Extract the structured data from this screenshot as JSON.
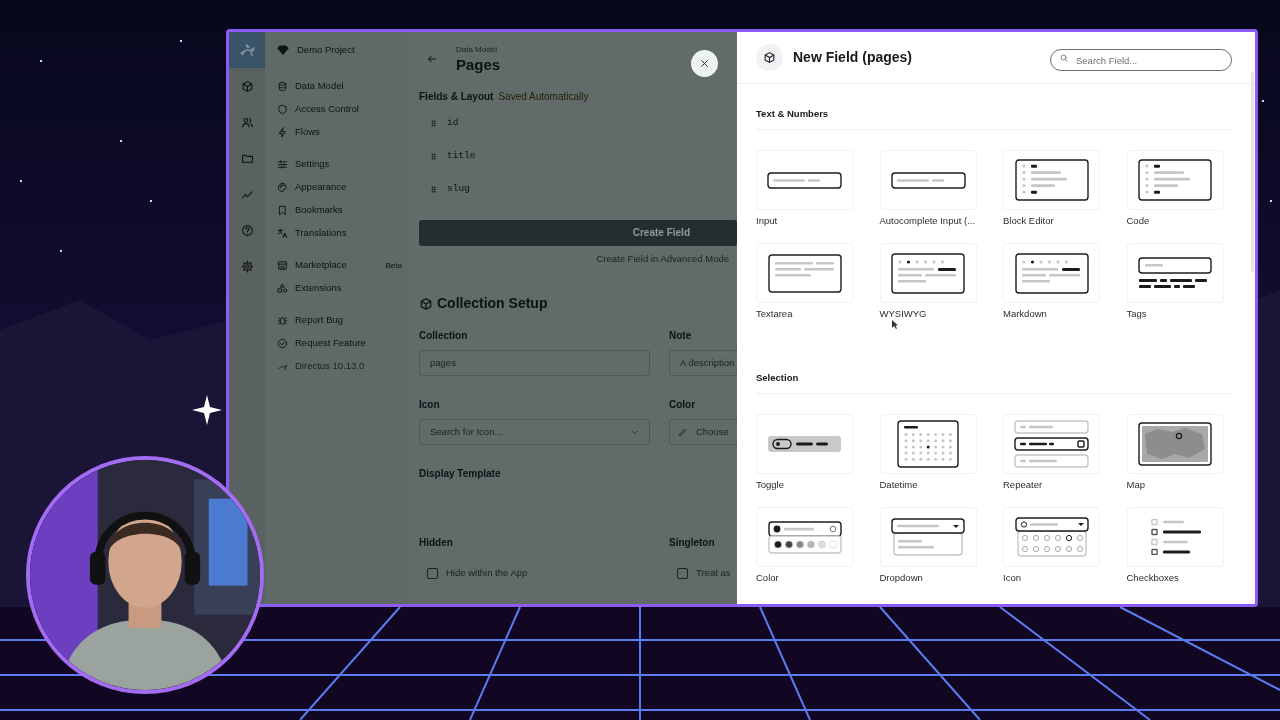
{
  "sidebar": {
    "project": "Demo Project",
    "groups": [
      {
        "items": [
          {
            "label": "Data Model"
          },
          {
            "label": "Access Control"
          },
          {
            "label": "Flows"
          }
        ]
      },
      {
        "items": [
          {
            "label": "Settings"
          },
          {
            "label": "Appearance"
          },
          {
            "label": "Bookmarks"
          },
          {
            "label": "Translations"
          }
        ]
      },
      {
        "items": [
          {
            "label": "Marketplace",
            "badge": "Beta"
          },
          {
            "label": "Extensions"
          }
        ]
      },
      {
        "items": [
          {
            "label": "Report Bug"
          },
          {
            "label": "Request Feature"
          }
        ]
      }
    ],
    "version": "Directus 10.13.0"
  },
  "header": {
    "breadcrumb": "Data Model",
    "title": "Pages"
  },
  "fields_layout": {
    "heading": "Fields & Layout",
    "status": "Saved Automatically",
    "fields": [
      "id",
      "title",
      "slug"
    ],
    "create_button": "Create Field",
    "advanced_link": "Create Field in Advanced Mode"
  },
  "collection_setup": {
    "title": "Collection Setup",
    "fields": [
      {
        "label": "Collection",
        "kind": "input",
        "value": "pages"
      },
      {
        "label": "Note",
        "kind": "input",
        "placeholder": "A description"
      },
      {
        "label": "Icon",
        "kind": "select",
        "placeholder": "Search for Icon..."
      },
      {
        "label": "Color",
        "kind": "color",
        "placeholder": "Choose"
      },
      {
        "label": "Display Template",
        "kind": "template"
      },
      {
        "label": "Hidden",
        "kind": "checkbox",
        "text": "Hide within the App",
        "checked": false
      },
      {
        "label": "Singleton",
        "kind": "checkbox",
        "text": "Treat as",
        "checked": false
      }
    ]
  },
  "drawer": {
    "title": "New Field (pages)",
    "search": {
      "placeholder": "Search Field..."
    },
    "sections": [
      {
        "title": "Text & Numbers",
        "options": [
          {
            "label": "Input",
            "kind": "input"
          },
          {
            "label": "Autocomplete Input (...",
            "kind": "autocomplete"
          },
          {
            "label": "Block Editor",
            "kind": "block"
          },
          {
            "label": "Code",
            "kind": "code"
          },
          {
            "label": "Textarea",
            "kind": "textarea"
          },
          {
            "label": "WYSIWYG",
            "kind": "wysiwyg"
          },
          {
            "label": "Markdown",
            "kind": "markdown"
          },
          {
            "label": "Tags",
            "kind": "tags"
          }
        ]
      },
      {
        "title": "Selection",
        "options": [
          {
            "label": "Toggle",
            "kind": "toggle"
          },
          {
            "label": "Datetime",
            "kind": "datetime"
          },
          {
            "label": "Repeater",
            "kind": "repeater"
          },
          {
            "label": "Map",
            "kind": "map"
          },
          {
            "label": "Color",
            "kind": "color"
          },
          {
            "label": "Dropdown",
            "kind": "dropdown"
          },
          {
            "label": "Icon",
            "kind": "icon"
          },
          {
            "label": "Checkboxes",
            "kind": "checkboxes"
          }
        ]
      }
    ]
  }
}
